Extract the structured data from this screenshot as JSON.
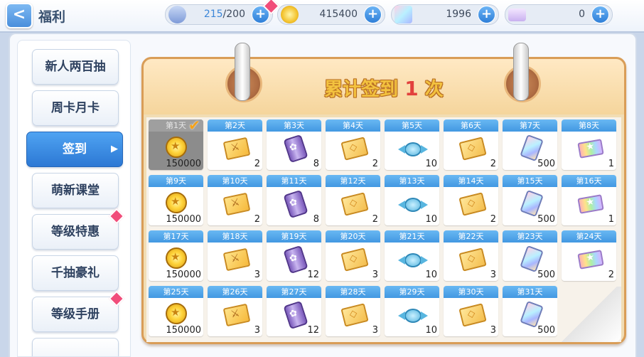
{
  "header": {
    "back_label": "<",
    "title": "福利",
    "resources": [
      {
        "icon": "energy-can-icon",
        "current": "215",
        "total": "/200",
        "has_badge": true
      },
      {
        "icon": "coin-icon",
        "value": "415400"
      },
      {
        "icon": "gem-icon",
        "value": "1996"
      },
      {
        "icon": "ticket-icon",
        "value": "0"
      }
    ],
    "plus_label": "+"
  },
  "sidebar": {
    "items": [
      {
        "label": "新人两百抽",
        "active": false,
        "badge": false
      },
      {
        "label": "周卡月卡",
        "active": false,
        "badge": false
      },
      {
        "label": "签到",
        "active": true,
        "badge": false
      },
      {
        "label": "萌新课堂",
        "active": false,
        "badge": false
      },
      {
        "label": "等级特惠",
        "active": false,
        "badge": true
      },
      {
        "label": "千抽豪礼",
        "active": false,
        "badge": false
      },
      {
        "label": "等级手册",
        "active": false,
        "badge": true
      }
    ],
    "active_arrow": "▶"
  },
  "calendar": {
    "title_prefix": "累计签到",
    "count": "1",
    "title_suffix": "次",
    "check_mark": "✔",
    "days": [
      {
        "label": "第1天",
        "icon": "coin",
        "qty": "150000",
        "claimed": true
      },
      {
        "label": "第2天",
        "icon": "ticket-gold",
        "qty": "2"
      },
      {
        "label": "第3天",
        "icon": "can",
        "qty": "8"
      },
      {
        "label": "第4天",
        "icon": "card",
        "qty": "2"
      },
      {
        "label": "第5天",
        "icon": "candy",
        "qty": "10"
      },
      {
        "label": "第6天",
        "icon": "card",
        "qty": "2"
      },
      {
        "label": "第7天",
        "icon": "gem",
        "qty": "500"
      },
      {
        "label": "第8天",
        "icon": "rainbow",
        "qty": "1"
      },
      {
        "label": "第9天",
        "icon": "coin",
        "qty": "150000"
      },
      {
        "label": "第10天",
        "icon": "ticket-gold",
        "qty": "2"
      },
      {
        "label": "第11天",
        "icon": "can",
        "qty": "8"
      },
      {
        "label": "第12天",
        "icon": "card",
        "qty": "2"
      },
      {
        "label": "第13天",
        "icon": "candy",
        "qty": "10"
      },
      {
        "label": "第14天",
        "icon": "card",
        "qty": "2"
      },
      {
        "label": "第15天",
        "icon": "gem",
        "qty": "500"
      },
      {
        "label": "第16天",
        "icon": "rainbow",
        "qty": "1"
      },
      {
        "label": "第17天",
        "icon": "coin",
        "qty": "150000"
      },
      {
        "label": "第18天",
        "icon": "ticket-gold",
        "qty": "3"
      },
      {
        "label": "第19天",
        "icon": "can",
        "qty": "12"
      },
      {
        "label": "第20天",
        "icon": "card",
        "qty": "3"
      },
      {
        "label": "第21天",
        "icon": "candy",
        "qty": "10"
      },
      {
        "label": "第22天",
        "icon": "card",
        "qty": "3"
      },
      {
        "label": "第23天",
        "icon": "gem",
        "qty": "500"
      },
      {
        "label": "第24天",
        "icon": "rainbow",
        "qty": "2"
      },
      {
        "label": "第25天",
        "icon": "coin",
        "qty": "150000"
      },
      {
        "label": "第26天",
        "icon": "ticket-gold",
        "qty": "3"
      },
      {
        "label": "第27天",
        "icon": "can",
        "qty": "12"
      },
      {
        "label": "第28天",
        "icon": "card",
        "qty": "3"
      },
      {
        "label": "第29天",
        "icon": "candy",
        "qty": "10"
      },
      {
        "label": "第30天",
        "icon": "card",
        "qty": "3"
      },
      {
        "label": "第31天",
        "icon": "gem",
        "qty": "500"
      }
    ]
  }
}
